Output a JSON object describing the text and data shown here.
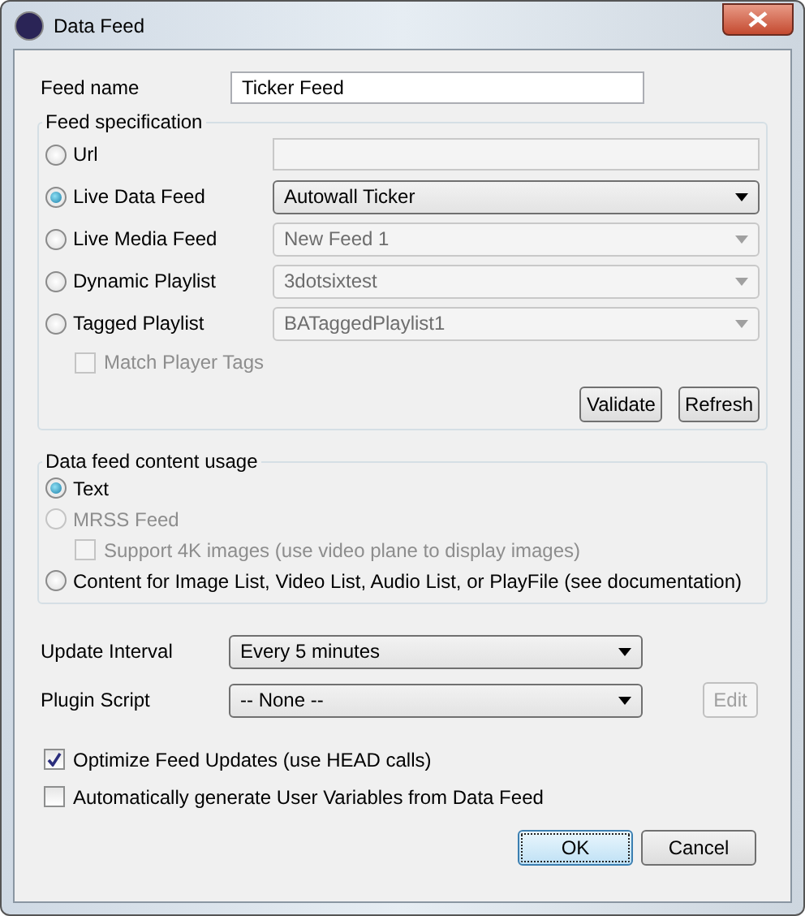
{
  "window": {
    "title": "Data Feed"
  },
  "feed_name": {
    "label": "Feed name",
    "value": "Ticker Feed"
  },
  "feed_specification": {
    "title": "Feed specification",
    "items": [
      {
        "kind": "radio",
        "label": "Url",
        "selected": false,
        "field": {
          "kind": "text",
          "disabled": true
        }
      },
      {
        "kind": "radio",
        "label": "Live Data Feed",
        "selected": true,
        "field": {
          "kind": "select",
          "value": "Autowall Ticker",
          "disabled": false
        }
      },
      {
        "kind": "radio",
        "label": "Live Media Feed",
        "selected": false,
        "field": {
          "kind": "select",
          "value": "New Feed 1",
          "disabled": true
        }
      },
      {
        "kind": "radio",
        "label": "Dynamic Playlist",
        "selected": false,
        "field": {
          "kind": "select",
          "value": "3dotsixtest",
          "disabled": true
        }
      },
      {
        "kind": "radio",
        "label": "Tagged Playlist",
        "selected": false,
        "field": {
          "kind": "select",
          "value": "BATaggedPlaylist1",
          "disabled": true
        }
      },
      {
        "kind": "checkbox",
        "label": "Match Player Tags",
        "checked": false,
        "disabled": true
      }
    ],
    "buttons": [
      {
        "label": "Validate"
      },
      {
        "label": "Refresh"
      }
    ]
  },
  "content_usage": {
    "title": "Data feed content usage",
    "items": [
      {
        "kind": "radio",
        "label": "Text",
        "selected": true,
        "disabled": false
      },
      {
        "kind": "radio",
        "label": "MRSS Feed",
        "selected": false,
        "disabled": true
      },
      {
        "kind": "checkbox",
        "label": "Support 4K images (use video plane to display images)",
        "checked": false,
        "disabled": true
      },
      {
        "kind": "radio",
        "label": "Content for Image List, Video List, Audio List, or PlayFile (see documentation)",
        "selected": false,
        "disabled": false
      }
    ]
  },
  "update_interval": {
    "label": "Update Interval",
    "value": "Every 5 minutes"
  },
  "plugin_script": {
    "label": "Plugin Script",
    "value": "-- None --",
    "edit_button": {
      "label": "Edit",
      "disabled": true
    }
  },
  "options": [
    {
      "label": "Optimize Feed Updates (use HEAD calls)",
      "checked": true
    },
    {
      "label": "Automatically generate User Variables from Data Feed",
      "checked": false
    }
  ],
  "buttons": [
    {
      "label": "OK",
      "default": true
    },
    {
      "label": "Cancel",
      "default": false
    }
  ]
}
